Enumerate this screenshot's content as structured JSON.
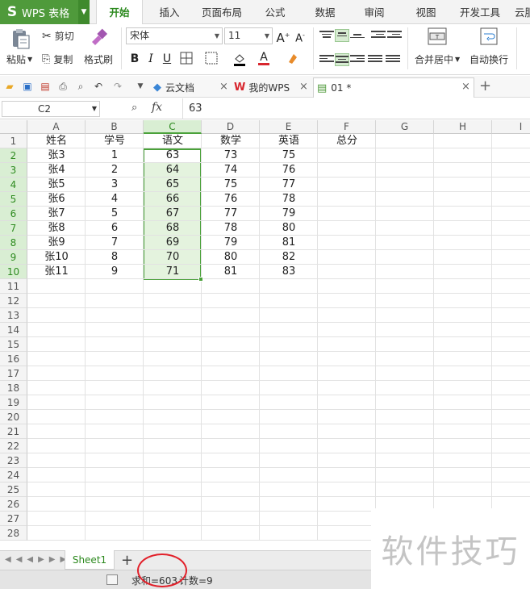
{
  "app": {
    "logo": "S",
    "name": "WPS 表格"
  },
  "menu_tabs": [
    "开始",
    "插入",
    "页面布局",
    "公式",
    "数据",
    "审阅",
    "视图",
    "开发工具",
    "云服"
  ],
  "ribbon": {
    "paste": "粘贴",
    "cut": "剪切",
    "copy": "复制",
    "format_painter": "格式刷",
    "font_name": "宋体",
    "font_size": "11",
    "bold": "B",
    "italic": "I",
    "underline": "U",
    "merge_center": "合并居中",
    "wrap_text": "自动换行"
  },
  "doc_tabs": [
    {
      "label": "云文档"
    },
    {
      "label": "我的WPS"
    },
    {
      "label": "01 *"
    }
  ],
  "formula_bar": {
    "cell_ref": "C2",
    "fx": "fx",
    "value": "63"
  },
  "columns": [
    "A",
    "B",
    "C",
    "D",
    "E",
    "F",
    "G",
    "H",
    "I"
  ],
  "rows": [
    "1",
    "2",
    "3",
    "4",
    "5",
    "6",
    "7",
    "8",
    "9",
    "10",
    "11",
    "12",
    "13",
    "14",
    "15",
    "16",
    "17",
    "18",
    "19",
    "20",
    "21",
    "22",
    "23",
    "24",
    "25",
    "26",
    "27",
    "28"
  ],
  "table": {
    "headers": [
      "姓名",
      "学号",
      "语文",
      "数学",
      "英语",
      "总分"
    ],
    "data": [
      [
        "张3",
        "1",
        "63",
        "73",
        "75"
      ],
      [
        "张4",
        "2",
        "64",
        "74",
        "76"
      ],
      [
        "张5",
        "3",
        "65",
        "75",
        "77"
      ],
      [
        "张6",
        "4",
        "66",
        "76",
        "78"
      ],
      [
        "张7",
        "5",
        "67",
        "77",
        "79"
      ],
      [
        "张8",
        "6",
        "68",
        "78",
        "80"
      ],
      [
        "张9",
        "7",
        "69",
        "79",
        "81"
      ],
      [
        "张10",
        "8",
        "70",
        "80",
        "82"
      ],
      [
        "张11",
        "9",
        "71",
        "81",
        "83"
      ]
    ]
  },
  "sheet": {
    "name": "Sheet1",
    "add": "+"
  },
  "status": {
    "sum": "求和=603",
    "count": "计数=9"
  },
  "watermark": "软件技巧",
  "colors": {
    "accent": "#4f9a3b",
    "selection_fill": "#e4f3de",
    "annotation": "#e2202a"
  }
}
